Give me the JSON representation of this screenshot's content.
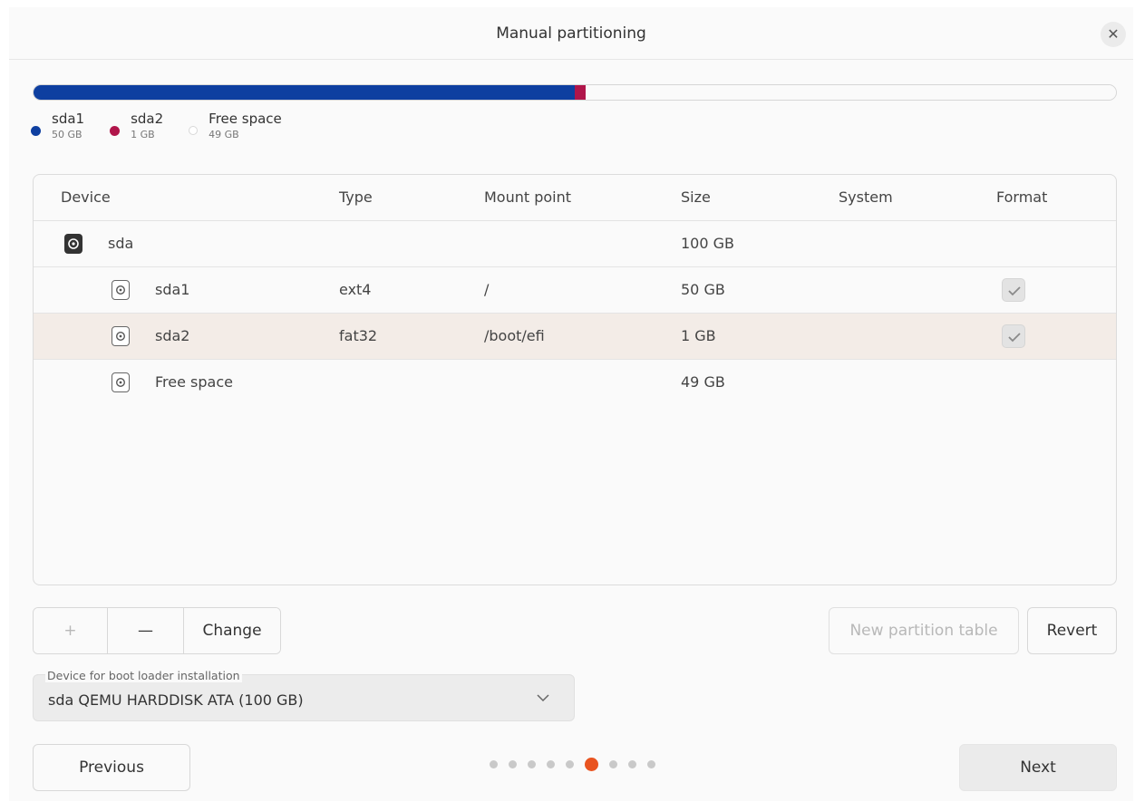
{
  "window": {
    "title": "Manual partitioning"
  },
  "usage": {
    "segments": [
      {
        "name": "sda1",
        "size": "50 GB",
        "fraction": 0.5,
        "color": "#0e3fa0"
      },
      {
        "name": "sda2",
        "size": "1 GB",
        "fraction": 0.01,
        "color": "#b0154a"
      },
      {
        "name": "Free space",
        "size": "49 GB",
        "fraction": 0.49,
        "color": "#fafafa"
      }
    ]
  },
  "table": {
    "headers": {
      "device": "Device",
      "type": "Type",
      "mount": "Mount point",
      "size": "Size",
      "system": "System",
      "format": "Format"
    },
    "rows": [
      {
        "device": "sda",
        "type": "",
        "mount": "",
        "size": "100 GB",
        "format": false,
        "level": 0,
        "icon": "harddisk-icon"
      },
      {
        "device": "sda1",
        "type": "ext4",
        "mount": "/",
        "size": "50 GB",
        "format": true,
        "level": 1,
        "icon": "partition-icon"
      },
      {
        "device": "sda2",
        "type": "fat32",
        "mount": "/boot/efi",
        "size": "1 GB",
        "format": true,
        "level": 1,
        "icon": "partition-icon",
        "selected": true
      },
      {
        "device": "Free space",
        "type": "",
        "mount": "",
        "size": "49 GB",
        "format": false,
        "level": 1,
        "icon": "partition-icon"
      }
    ]
  },
  "toolbar": {
    "add": "+",
    "remove": "—",
    "change": "Change",
    "new_table": "New partition table",
    "revert": "Revert"
  },
  "bootloader": {
    "label": "Device for boot loader installation",
    "value": "sda QEMU HARDDISK ATA (100 GB)"
  },
  "footer": {
    "previous": "Previous",
    "next": "Next",
    "steps_total": 9,
    "current_step": 6
  },
  "colors": {
    "accent": "#e95420",
    "sda1": "#0e3fa0",
    "sda2": "#b0154a"
  }
}
